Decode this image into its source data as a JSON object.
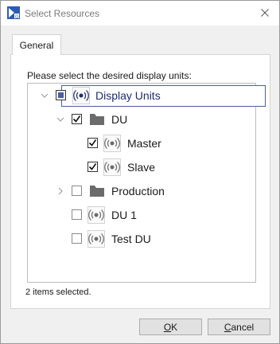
{
  "window": {
    "title": "Select Resources"
  },
  "tabs": [
    {
      "label": "General",
      "selected": true
    }
  ],
  "panel": {
    "prompt": "Please select the desired display units:"
  },
  "tree": {
    "root": {
      "label": "Display Units",
      "check_state": "partial",
      "expanded": true
    },
    "items": [
      {
        "label": "DU",
        "type": "folder",
        "checked": true,
        "expanded": true
      },
      {
        "label": "Master",
        "type": "display-unit",
        "checked": true
      },
      {
        "label": "Slave",
        "type": "display-unit",
        "checked": true
      },
      {
        "label": "Production",
        "type": "folder",
        "checked": false,
        "expanded": false
      },
      {
        "label": "DU 1",
        "type": "display-unit",
        "checked": false
      },
      {
        "label": "Test DU",
        "type": "display-unit",
        "checked": false
      }
    ]
  },
  "status": {
    "text": "2 items selected."
  },
  "buttons": {
    "ok": {
      "mnemonic": "O",
      "rest": "K"
    },
    "cancel": {
      "mnemonic": "C",
      "rest": "ancel"
    }
  },
  "colors": {
    "selection_border": "#4a5f9e",
    "root_label": "#1e2c74",
    "folder_icon": "#6b6b6b"
  }
}
